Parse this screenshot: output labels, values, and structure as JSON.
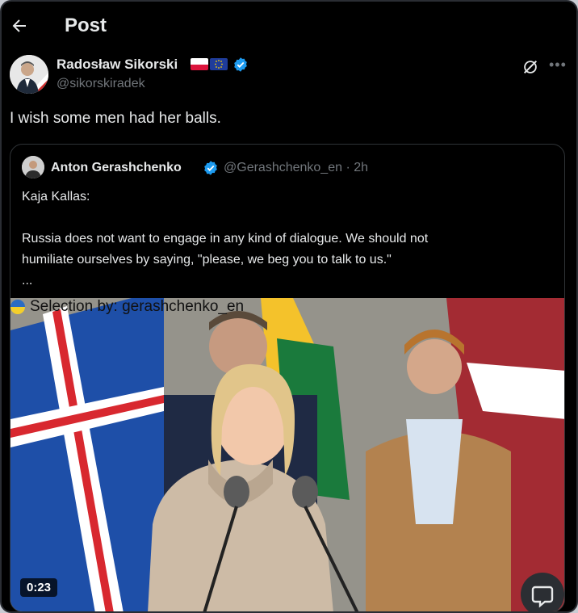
{
  "header": {
    "title": "Post"
  },
  "post": {
    "author_name": "Radosław Sikorski",
    "author_handle": "@sikorskiradek",
    "text": "I wish some men had her balls."
  },
  "quote": {
    "author_name": "Anton Gerashchenko",
    "author_handle": "@Gerashchenko_en · 2h",
    "line1": "Kaja Kallas:",
    "line2": "Russia does not want to engage in any kind of dialogue. We should not",
    "line3": "humiliate ourselves by saying, \"please, we beg you to talk to us.\"",
    "line4": "..."
  },
  "video": {
    "caption": "Selection by: gerashchenko_en",
    "duration": "0:23"
  },
  "icons": {
    "back": "arrow-left-icon",
    "verified": "verified-badge-icon",
    "grok": "grok-icon",
    "more": "more-icon",
    "chat": "chat-icon"
  },
  "colors": {
    "background": "#000000",
    "text": "#e7e9ea",
    "muted": "#71767b",
    "verified": "#1d9bf0"
  }
}
